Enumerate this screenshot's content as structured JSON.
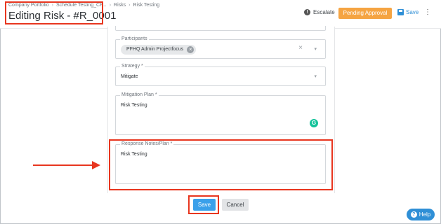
{
  "breadcrumb": [
    "Company Portfolio",
    "Schedule Testing_CP...",
    "Risks",
    "Risk Testing"
  ],
  "header": {
    "title": "Editing Risk - #R_0001",
    "escalate_label": "Escalate",
    "pending_label": "Pending Approval",
    "save_label": "Save"
  },
  "form": {
    "participants": {
      "label": "Participants",
      "chip": "PFHQ Admin Projectfocus"
    },
    "strategy": {
      "label": "Strategy *",
      "value": "Mitigate"
    },
    "mitigation_plan": {
      "label": "Mitigation Plan *",
      "value": "Risk Testing"
    },
    "response_notes": {
      "label": "Response Notes/Plan *",
      "value": "Risk Testing"
    }
  },
  "footer": {
    "save_label": "Save",
    "cancel_label": "Cancel"
  },
  "help": {
    "label": "Help"
  },
  "icons": {
    "escalate": "alert-circle-icon",
    "save": "floppy-disk-icon",
    "more": "kebab-menu-icon",
    "grammarly": "grammarly-icon",
    "help": "question-circle-icon"
  },
  "colors": {
    "accent": "#2f8fd6",
    "pending": "#f5a442",
    "annotation": "#e8361f",
    "save_button": "#3aa0ea"
  }
}
